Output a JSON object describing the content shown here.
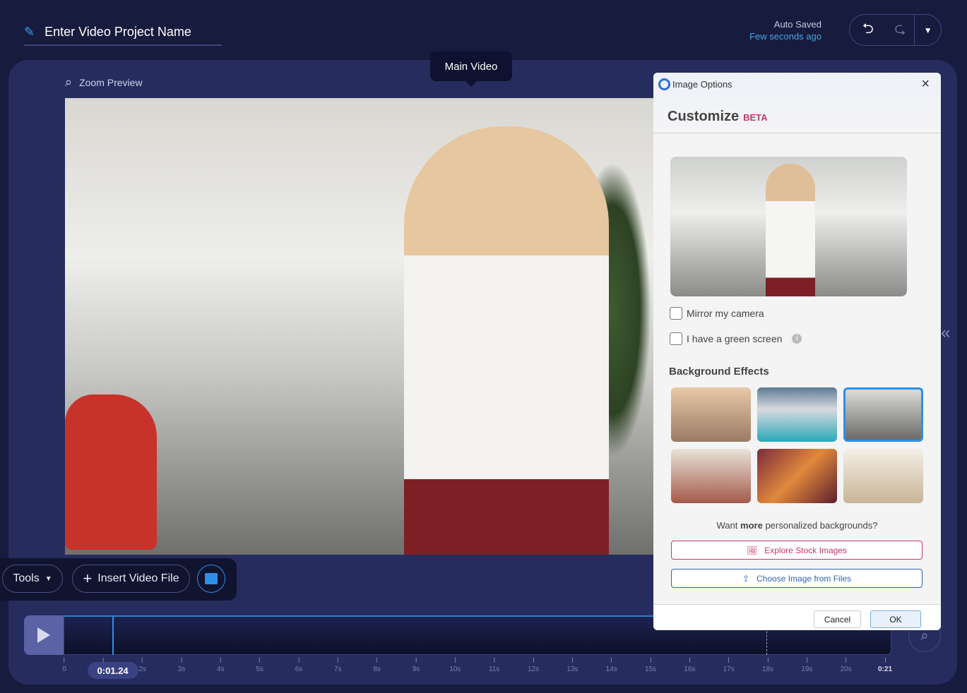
{
  "header": {
    "project_name": "Enter Video Project Name",
    "auto_saved": "Auto Saved",
    "saved_time": "Few seconds ago"
  },
  "preview": {
    "zoom_label": "Zoom Preview",
    "main_video_label": "Main Video"
  },
  "toolbar": {
    "tools": "Tools",
    "insert_video": "Insert Video File"
  },
  "timeline": {
    "current_time": "0:01.24",
    "ticks": [
      "0",
      "1s",
      "2s",
      "3s",
      "4s",
      "5s",
      "6s",
      "7s",
      "8s",
      "9s",
      "10s",
      "11s",
      "12s",
      "13s",
      "14s",
      "15s",
      "16s",
      "17s",
      "18s",
      "19s",
      "20s",
      "0:21"
    ],
    "playhead_seconds": 1.24,
    "duration_seconds": 21
  },
  "dialog": {
    "window_title": "Image Options",
    "heading": "Customize",
    "badge": "BETA",
    "mirror": "Mirror my camera",
    "green": "I have a green screen",
    "bg_effects": "Background Effects",
    "more_prefix": "Want ",
    "more_bold": "more",
    "more_suffix": " personalized backgrounds?",
    "explore": "Explore Stock Images",
    "choose": "Choose Image from Files",
    "cancel": "Cancel",
    "ok": "OK",
    "backgrounds": [
      "city-skyline",
      "mountain-lake",
      "office",
      "interior-room",
      "canyon",
      "living-room"
    ],
    "selected_background": "office"
  },
  "colors": {
    "accent": "#2e8fe6",
    "beta": "#c0396b",
    "explore": "#c0396b",
    "choose": "#2f67b1"
  }
}
